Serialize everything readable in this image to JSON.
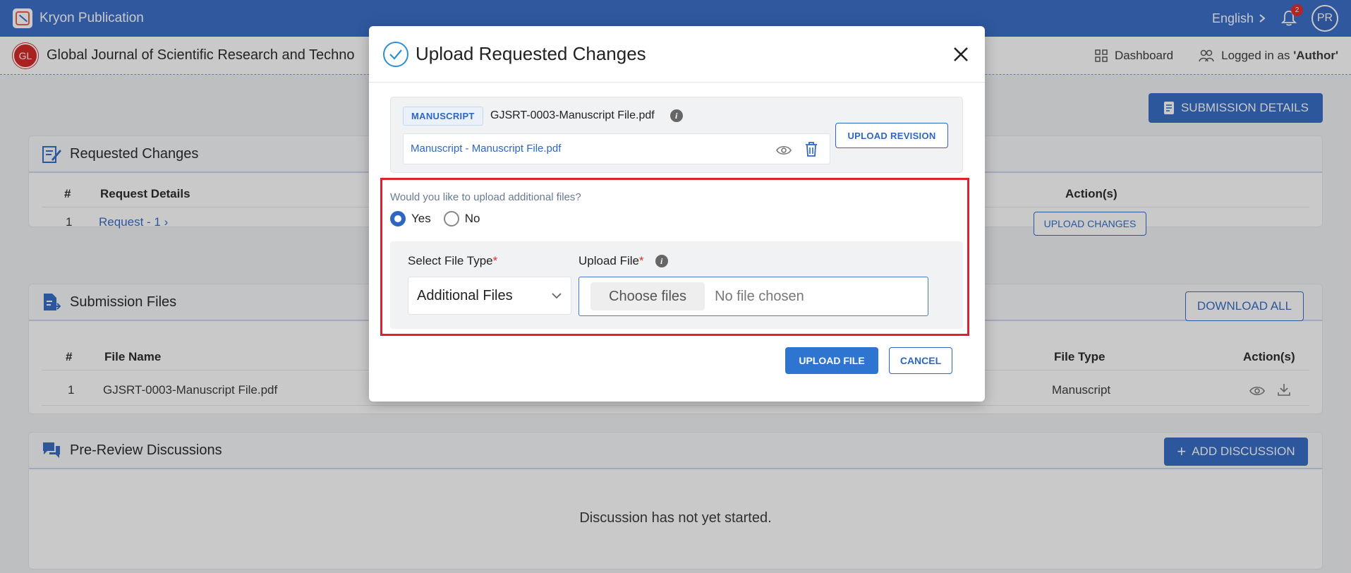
{
  "topbar": {
    "app_title": "Kryon Publication",
    "language": "English",
    "notification_count": "2",
    "avatar_initials": "PR",
    "color": "#3268c6"
  },
  "journal": {
    "logo_initials": "GL",
    "title": "Global Journal of Scientific Research and Techno",
    "dashboard_label": "Dashboard",
    "logged_in_prefix": "Logged in as ",
    "logged_in_role": "'Author'"
  },
  "actions": {
    "submission_details": "SUBMISSION DETAILS"
  },
  "requested_changes": {
    "title": "Requested Changes",
    "headers": {
      "num": "#",
      "details": "Request Details",
      "actions": "Action(s)"
    },
    "rows": [
      {
        "num": "1",
        "details": "Request - 1",
        "action": "UPLOAD CHANGES"
      }
    ]
  },
  "submission_files": {
    "title": "Submission Files",
    "download_all": "DOWNLOAD ALL",
    "headers": {
      "num": "#",
      "file_name": "File Name",
      "file_type": "File Type",
      "actions": "Action(s)"
    },
    "rows": [
      {
        "num": "1",
        "file_name": "GJSRT-0003-Manuscript File.pdf",
        "file_type": "Manuscript"
      }
    ]
  },
  "discussions": {
    "title": "Pre-Review Discussions",
    "add_button": "ADD DISCUSSION",
    "empty_message": "Discussion has not yet started."
  },
  "modal": {
    "title": "Upload Requested Changes",
    "file_tag": "MANUSCRIPT",
    "file_name": "GJSRT-0003-Manuscript File.pdf",
    "file_link": "Manuscript - Manuscript File.pdf",
    "upload_revision": "UPLOAD REVISION",
    "question": "Would you like to upload additional files?",
    "radio_yes": "Yes",
    "radio_no": "No",
    "selected": "Yes",
    "file_type_label": "Select File Type",
    "required_mark": "*",
    "file_type_value": "Additional Files",
    "upload_label": "Upload File",
    "choose_files": "Choose files",
    "no_file": "No file chosen",
    "upload_file_btn": "UPLOAD FILE",
    "cancel_btn": "CANCEL",
    "highlight_color": "#e0202a"
  }
}
